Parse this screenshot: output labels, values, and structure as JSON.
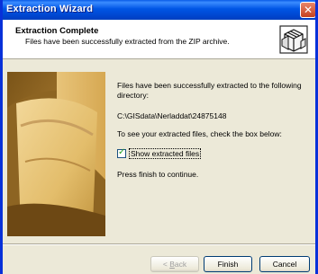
{
  "window": {
    "title": "Extraction Wizard",
    "close_glyph": "✕"
  },
  "header": {
    "title": "Extraction Complete",
    "subtitle": "Files have been successfully extracted from the ZIP archive.",
    "icon": "zip-archive-icon"
  },
  "content": {
    "message": "Files have been successfully extracted to the following directory:",
    "directory": "C:\\GISdata\\Nerladdat\\24875148",
    "check_instruction": "To see your extracted files, check the box below:",
    "show_files_checkbox": {
      "label": "Show extracted files",
      "checked": true
    },
    "finish_instruction": "Press finish to continue."
  },
  "buttons": {
    "back_prefix": "< ",
    "back_mnemonic": "B",
    "back_rest": "ack",
    "finish": "Finish",
    "cancel": "Cancel"
  },
  "colors": {
    "title_bar": "#0055e5",
    "dialog_bg": "#ece9d8",
    "close_button": "#c5411f"
  }
}
